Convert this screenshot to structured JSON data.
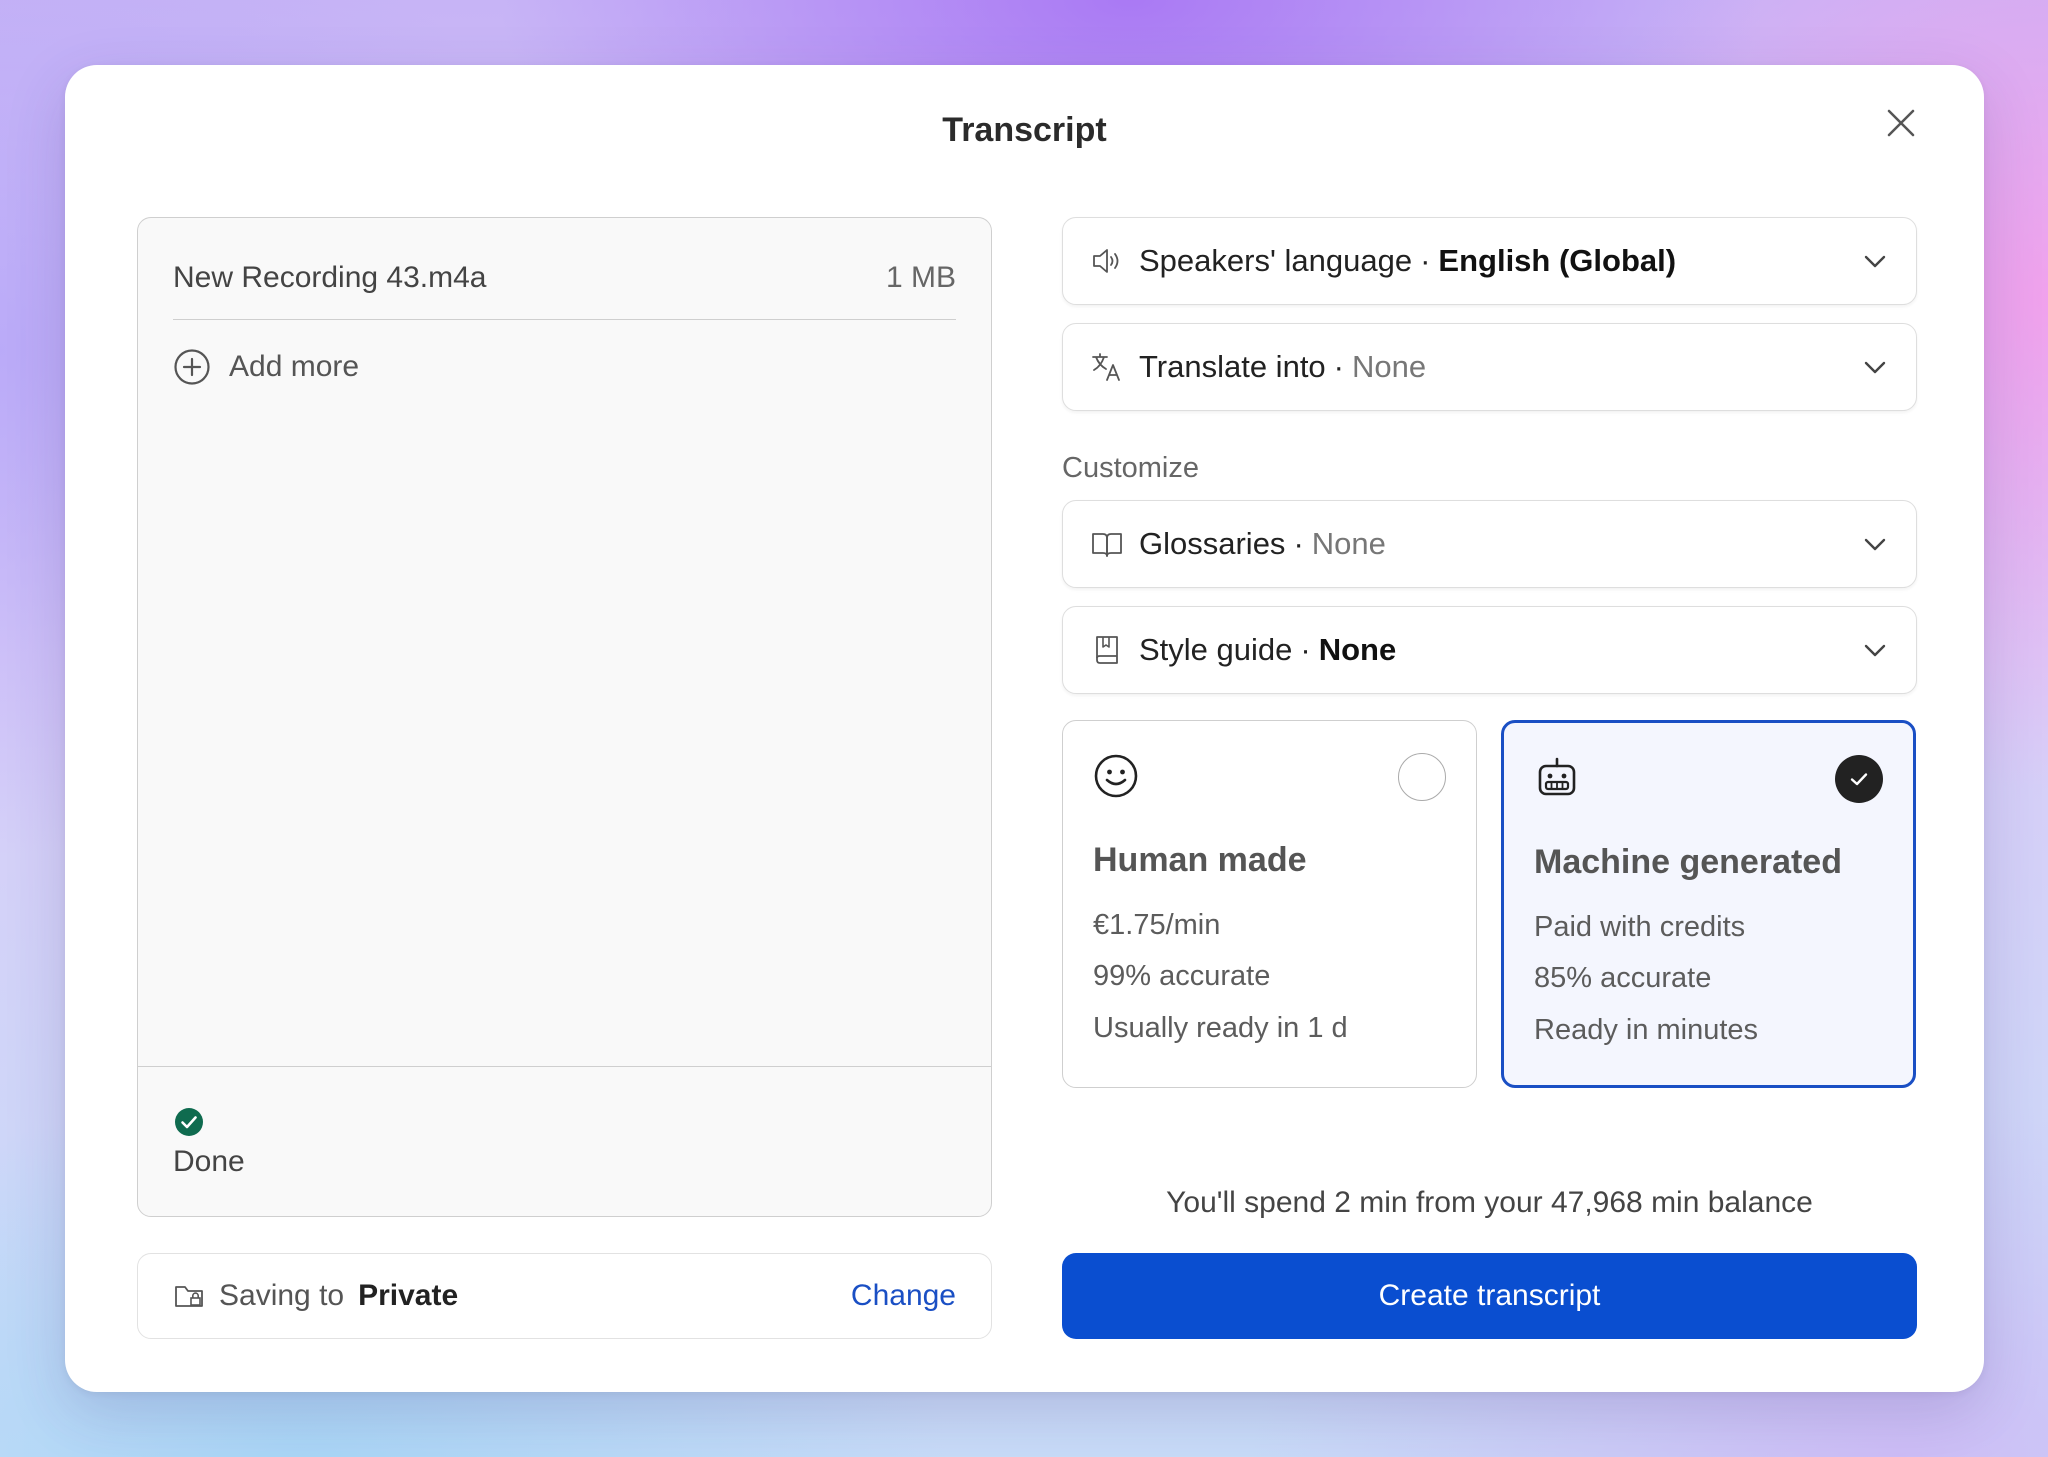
{
  "dialog": {
    "title": "Transcript"
  },
  "files": {
    "items": [
      {
        "name": "New Recording 43.m4a",
        "size": "1 MB"
      }
    ],
    "add_more_label": "Add more",
    "status_label": "Done"
  },
  "saving": {
    "label": "Saving to",
    "location": "Private",
    "change_label": "Change"
  },
  "settings": {
    "speakers_language": {
      "label": "Speakers' language",
      "separator": "·",
      "value": "English (Global)"
    },
    "translate_into": {
      "label": "Translate into",
      "separator": "·",
      "value": "None"
    },
    "customize_label": "Customize",
    "glossaries": {
      "label": "Glossaries",
      "separator": "·",
      "value": "None"
    },
    "style_guide": {
      "label": "Style guide",
      "separator": "·",
      "value": "None"
    }
  },
  "options": {
    "human": {
      "title": "Human made",
      "lines": [
        "€1.75/min",
        "99% accurate",
        "Usually ready in 1 d"
      ],
      "selected": false,
      "icon": "smiley-icon"
    },
    "machine": {
      "title": "Machine generated",
      "lines": [
        "Paid with credits",
        "85% accurate",
        "Ready in minutes"
      ],
      "selected": true,
      "icon": "robot-icon"
    }
  },
  "footer": {
    "balance_text": "You'll spend 2 min from your 47,968 min balance",
    "create_label": "Create transcript"
  },
  "colors": {
    "accent": "#0a4ed0",
    "link": "#1a4fc4",
    "success": "#0f6b4f"
  }
}
